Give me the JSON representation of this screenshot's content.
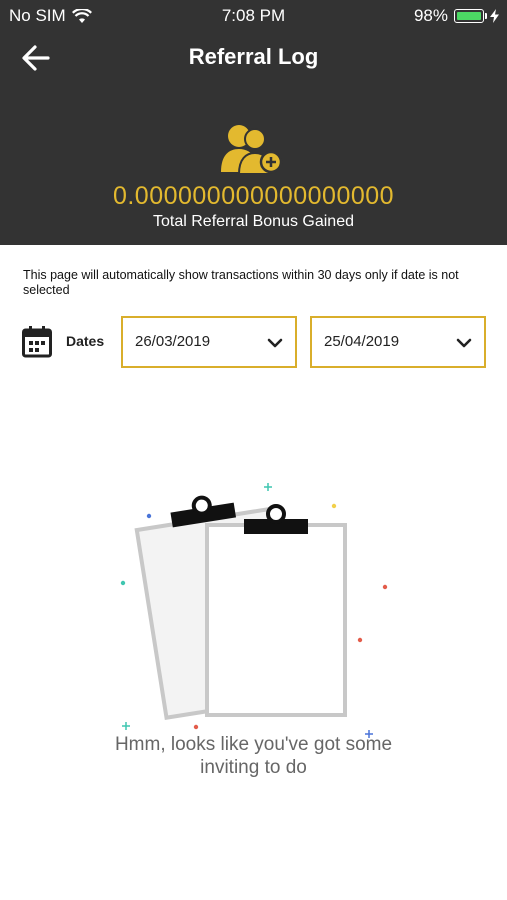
{
  "status_bar": {
    "carrier": "No SIM",
    "time": "7:08 PM",
    "battery_percent": "98%",
    "wifi_icon": "wifi-icon",
    "battery_icon": "battery-icon",
    "charging_icon": "bolt-icon"
  },
  "header": {
    "back_icon": "arrow-left-icon",
    "title": "Referral Log",
    "users_icon": "users-add-icon",
    "bonus_amount": "0.000000000000000000",
    "bonus_label": "Total Referral Bonus Gained",
    "accent_color": "#e3b92f",
    "background_color": "#333333"
  },
  "filter": {
    "info_text": "This page will automatically show transactions within 30 days only if date is not selected",
    "dates_label": "Dates",
    "calendar_icon": "calendar-icon",
    "start_date": "26/03/2019",
    "end_date": "25/04/2019",
    "border_color": "#d9ae2b"
  },
  "empty_state": {
    "illustration": "clipboards-illustration",
    "message_line1": "Hmm, looks like you've got some",
    "message_line2": "inviting to do"
  }
}
